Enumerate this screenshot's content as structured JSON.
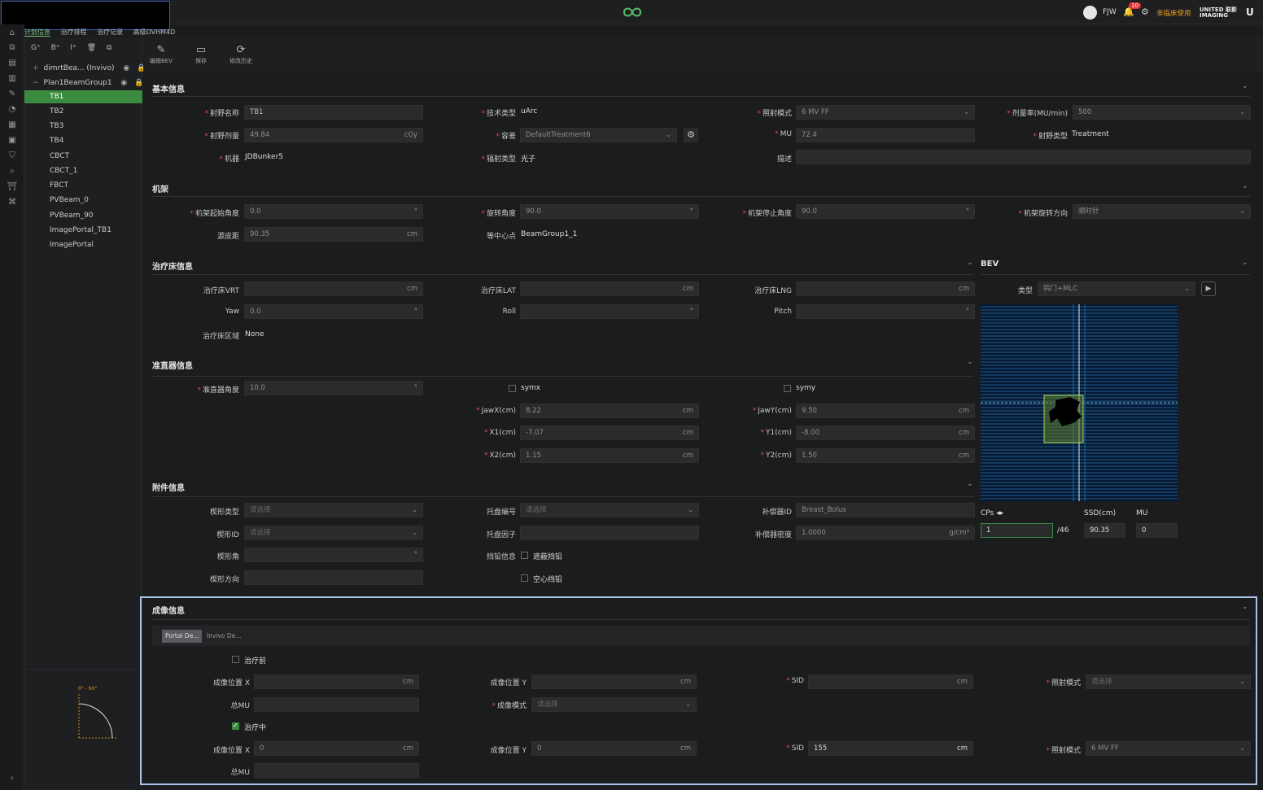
{
  "topbar": {
    "user": "FJW",
    "notif_count": "10",
    "warning": "非临床使用",
    "brand": "UNITED 联影 IMAGING"
  },
  "nav_tabs": [
    "计划信息",
    "治疗排程",
    "治疗记录",
    "高级DVHM4D"
  ],
  "tree": {
    "toolbar": [
      "G⁺",
      "B⁺",
      "I⁺",
      "🗑",
      "⧉"
    ],
    "groups": [
      {
        "label": "dimrtBea... (Invivo)"
      },
      {
        "label": "Plan1BeamGroup1"
      }
    ],
    "beams": [
      "TB1",
      "TB2",
      "TB3",
      "TB4",
      "CBCT",
      "CBCT_1",
      "FBCT",
      "PVBeam_0",
      "PVBeam_90",
      "ImagePortal_TB1",
      "ImagePortal"
    ],
    "selected": "TB1",
    "angle_label": "0° - 90°"
  },
  "toolbar": {
    "edit_bev": "编辑BEV",
    "save": "保存",
    "history": "修改历史"
  },
  "basic": {
    "title": "基本信息",
    "field_name_label": "射野名称",
    "field_name": "TB1",
    "tech_label": "技术类型",
    "tech": "uArc",
    "mode_label": "照射模式",
    "mode": "6 MV FF",
    "rate_label": "剂量率(MU/min)",
    "rate": "500",
    "dose_label": "射野剂量",
    "dose": "49.84",
    "dose_unit": "cGy",
    "tol_label": "容差",
    "tol": "DefaultTreatment6",
    "mu_label": "MU",
    "mu": "72.4",
    "ftype_label": "射野类型",
    "ftype": "Treatment",
    "machine_label": "机器",
    "machine": "JDBunker5",
    "rad_label": "辐射类型",
    "rad": "光子",
    "desc_label": "描述",
    "desc": ""
  },
  "gantry": {
    "title": "机架",
    "start_label": "机架起始角度",
    "start": "0.0",
    "rot_label": "旋转角度",
    "rot": "90.0",
    "stop_label": "机架停止角度",
    "stop": "90.0",
    "dir_label": "机架旋转方向",
    "dir": "顺时针",
    "ssd_label": "源皮距",
    "ssd": "90.35",
    "ssd_unit": "cm",
    "iso_label": "等中心点",
    "iso": "BeamGroup1_1"
  },
  "couch": {
    "title": "治疗床信息",
    "vrt_label": "治疗床VRT",
    "lat_label": "治疗床LAT",
    "lng_label": "治疗床LNG",
    "unit": "cm",
    "yaw_label": "Yaw",
    "yaw": "0.0",
    "roll_label": "Roll",
    "pitch_label": "Pitch",
    "region_label": "治疗床区域",
    "region": "None"
  },
  "coll": {
    "title": "准直器信息",
    "angle_label": "准直器角度",
    "angle": "10.0",
    "symx": "symx",
    "symy": "symy",
    "jawx_label": "JawX(cm)",
    "jawx": "8.22",
    "jawy_label": "JawY(cm)",
    "jawy": "9.50",
    "x1_label": "X1(cm)",
    "x1": "-7.07",
    "y1_label": "Y1(cm)",
    "y1": "-8.00",
    "x2_label": "X2(cm)",
    "x2": "1.15",
    "y2_label": "Y2(cm)",
    "y2": "1.50",
    "unit": "cm"
  },
  "acc": {
    "title": "附件信息",
    "wedge_type_label": "楔形类型",
    "wedge_type_ph": "请选择",
    "tray_no_label": "托盘编号",
    "tray_no_ph": "请选择",
    "bolus_id_label": "补偿器ID",
    "bolus_id": "Breast_Bolus",
    "wedge_id_label": "楔形ID",
    "wedge_id_ph": "请选择",
    "tray_factor_label": "托盘因子",
    "bolus_density_label": "补偿器密度",
    "bolus_density": "1.0000",
    "bolus_density_unit": "g/cm³",
    "wedge_angle_label": "楔形角",
    "block_info_label": "挡铅信息",
    "block1": "遮蔽挡铅",
    "block2": "空心挡铅",
    "wedge_dir_label": "楔形方向"
  },
  "bev": {
    "title": "BEV",
    "type_label": "类型",
    "type": "钨门+MLC",
    "cps_label": "CPs",
    "cps": "1",
    "cps_total": "/46",
    "ssd_label": "SSD(cm)",
    "ssd": "90.35",
    "mu_label": "MU",
    "mu": "0"
  },
  "imaging": {
    "title": "成像信息",
    "tabs": [
      "Portal De...",
      "Invivo De..."
    ],
    "pre_label": "治疗前",
    "during_label": "治疗中",
    "posx_label": "成像位置 X",
    "posy_label": "成像位置 Y",
    "sid_label": "SID",
    "mode_label": "照射模式",
    "total_mu_label": "总MU",
    "img_mode_label": "成像模式",
    "ph": "请选择",
    "unit": "cm",
    "pre": {
      "posx": "",
      "posy": "",
      "sid": ""
    },
    "during": {
      "posx": "0",
      "posy": "0",
      "sid": "155",
      "mode": "6 MV FF"
    }
  },
  "colors": {
    "accent": "#3a8a40",
    "highlight_border": "#a9c3e6",
    "required": "#e04c4c",
    "warning": "#f0a020"
  }
}
